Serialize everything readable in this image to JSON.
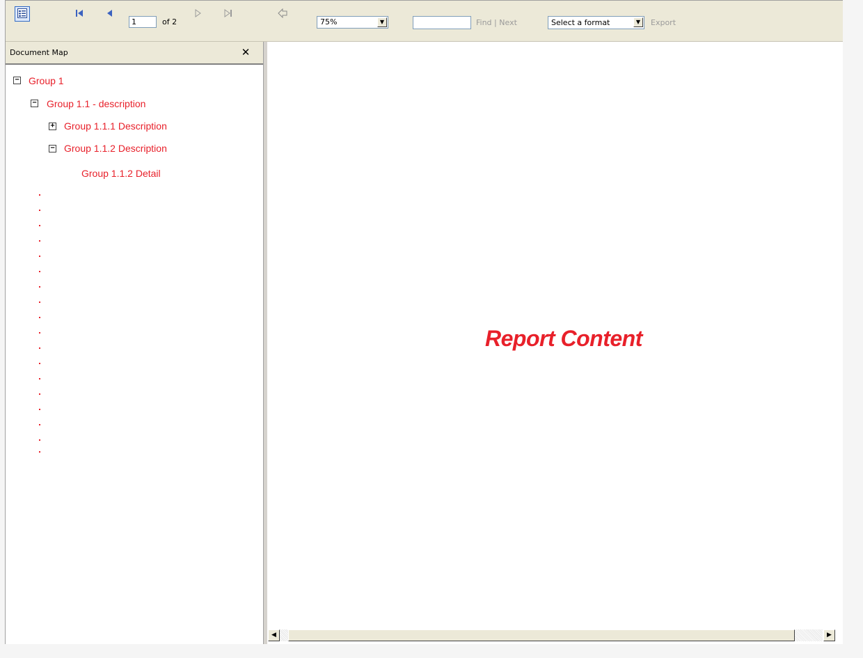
{
  "toolbar": {
    "page_value": "1",
    "of_label": "of 2",
    "zoom_value": "75%",
    "find_label": "Find",
    "separator": "|",
    "next_label": "Next",
    "format_value": "Select a format",
    "export_label": "Export"
  },
  "docmap": {
    "title": "Document Map",
    "nodes": [
      {
        "label": "Group 1",
        "toggle": "−"
      },
      {
        "label": "Group 1.1 - description",
        "toggle": "−"
      },
      {
        "label": "Group 1.1.1 Description",
        "toggle": "+"
      },
      {
        "label": "Group 1.1.2 Description",
        "toggle": "−"
      },
      {
        "label": "Group 1.1.2  Detail"
      }
    ]
  },
  "report": {
    "content_title": "Report Content"
  },
  "colors": {
    "accent_red": "#e8202a",
    "toolbar_bg": "#ece9d8"
  }
}
